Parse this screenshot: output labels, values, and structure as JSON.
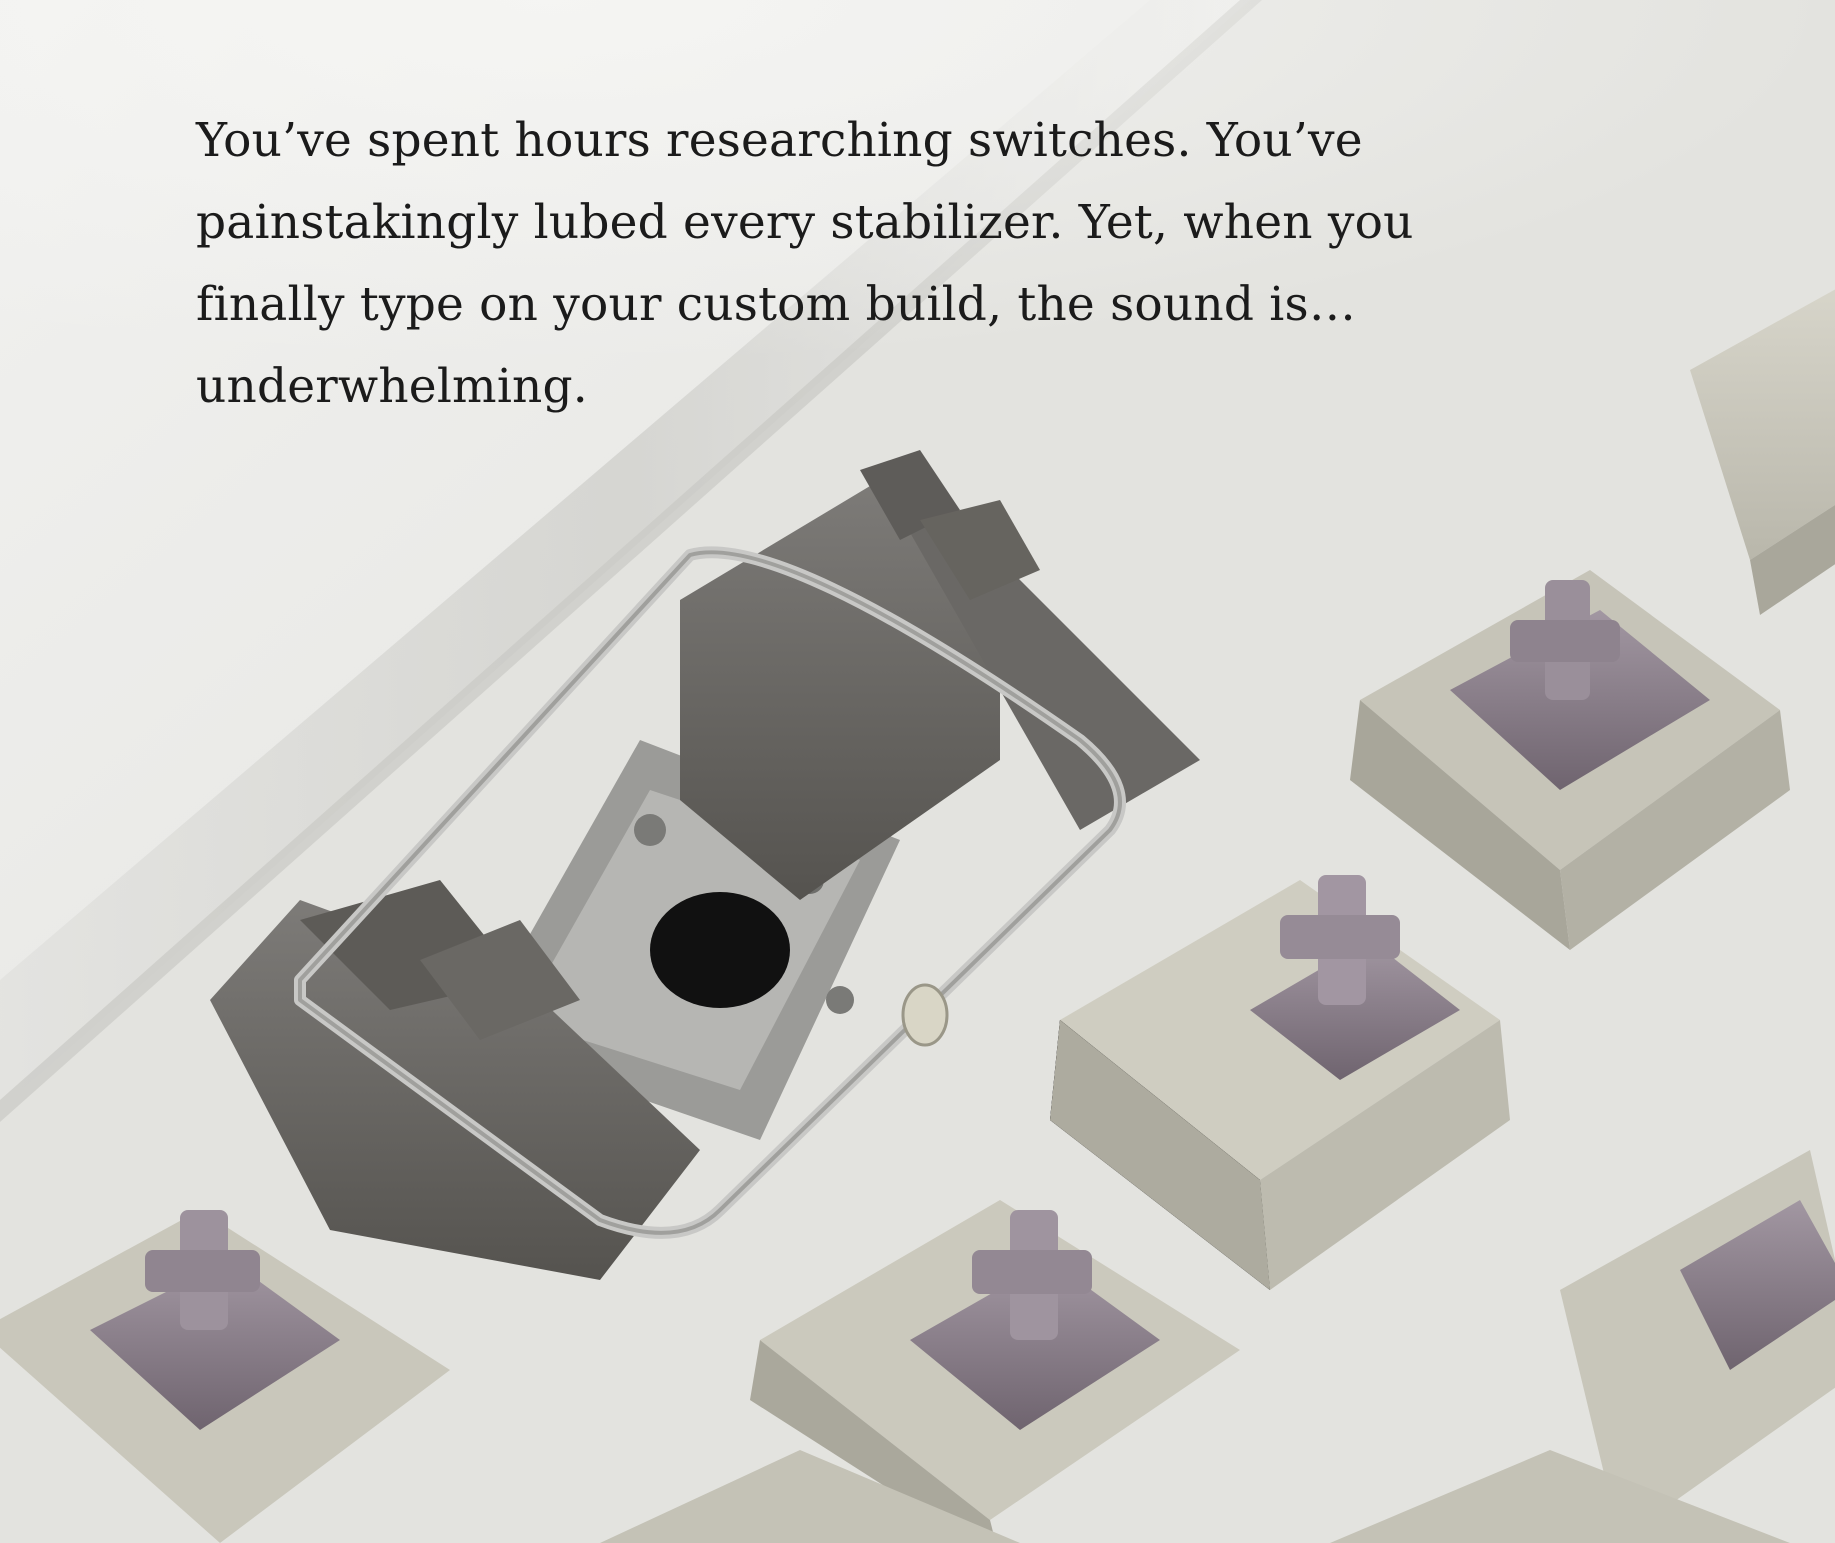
{
  "caption": {
    "lines": [
      "You’ve spent hours researching switches. You’ve",
      "painstakingly lubed every stabilizer. Yet, when you",
      "finally type on your custom build, the sound is…",
      "underwhelming."
    ]
  },
  "colors": {
    "background": "#ececea",
    "text": "#1b1b1b",
    "switch_housing": "#cfcdc2",
    "switch_stem": "#8a7f8a",
    "stabilizer_housing": "#6f6d6a",
    "stabilizer_wire": "#b9b9b9"
  }
}
